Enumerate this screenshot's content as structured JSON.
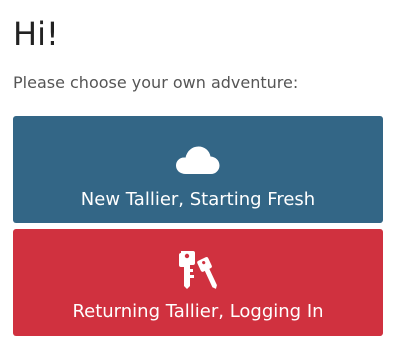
{
  "greeting": "Hi!",
  "prompt": "Please choose your own adventure:",
  "choices": [
    {
      "label": "New Tallier, Starting Fresh",
      "icon": "cloud-icon",
      "color": "#336686"
    },
    {
      "label": "Returning Tallier, Logging In",
      "icon": "keys-icon",
      "color": "#d0313f"
    }
  ]
}
